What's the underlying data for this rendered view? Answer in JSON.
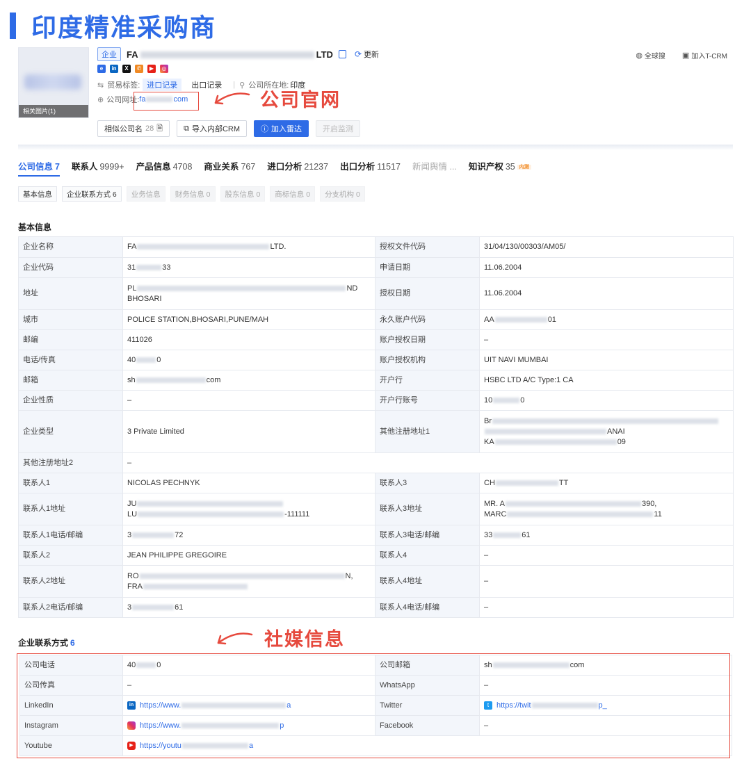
{
  "page_title": "印度精准采购商",
  "header": {
    "thumb_caption": "相关图片(1)",
    "tag": "企业",
    "company_name_start": "FA",
    "company_name_end": "LTD",
    "refresh_label": "更新",
    "trade_label": "贸易标签:",
    "trade_import": "进口记录",
    "trade_export": "出口记录",
    "location_label": "公司所在地:",
    "location_value": "印度",
    "website_label": "公司网址:",
    "website_start": "fa",
    "website_end": "com",
    "buttons": {
      "similar": "相似公司名",
      "similar_count": "28",
      "import_crm": "导入内部CRM",
      "add_radar": "加入雷达",
      "monitor": "开启监测"
    },
    "right": {
      "global_search": "全球搜",
      "add_crm": "加入T-CRM"
    }
  },
  "annotations": {
    "website": "公司官网",
    "social": "社媒信息"
  },
  "tabs": [
    {
      "label": "公司信息",
      "count": "7"
    },
    {
      "label": "联系人",
      "count": "9999+"
    },
    {
      "label": "产品信息",
      "count": "4708"
    },
    {
      "label": "商业关系",
      "count": "767"
    },
    {
      "label": "进口分析",
      "count": "21237"
    },
    {
      "label": "出口分析",
      "count": "11517"
    },
    {
      "label": "新闻舆情 ...",
      "count": ""
    },
    {
      "label": "知识产权",
      "count": "35",
      "badge": "内测"
    }
  ],
  "subtabs": [
    {
      "label": "基本信息"
    },
    {
      "label": "企业联系方式 6"
    },
    {
      "label": "业务信息"
    },
    {
      "label": "财务信息 0"
    },
    {
      "label": "股东信息 0"
    },
    {
      "label": "商标信息 0"
    },
    {
      "label": "分支机构 0"
    }
  ],
  "basic": {
    "title": "基本信息",
    "rows": [
      {
        "l1": "企业名称",
        "v1a": "FA",
        "v1b": "LTD.",
        "l2": "授权文件代码",
        "v2a": "31/04/130/00303/AM05/",
        "v2b": ""
      },
      {
        "l1": "企业代码",
        "v1a": "31",
        "v1b": "33",
        "l2": "申请日期",
        "v2a": "11.06.2004",
        "v2b": ""
      },
      {
        "l1": "地址",
        "v1a": "PL",
        "v1b": "ND",
        "v1c": "BHOSARI",
        "l2": "授权日期",
        "v2a": "11.06.2004",
        "v2b": ""
      },
      {
        "l1": "城市",
        "v1a": "POLICE STATION,BHOSARI,PUNE/MAH",
        "v1b": "",
        "l2": "永久账户代码",
        "v2a": "AA",
        "v2b": "01"
      },
      {
        "l1": "邮编",
        "v1a": "411026",
        "v1b": "",
        "l2": "账户授权日期",
        "v2a": "–",
        "v2b": ""
      },
      {
        "l1": "电话/传真",
        "v1a": "40",
        "v1b": "0",
        "l2": "账户授权机构",
        "v2a": "UIT NAVI MUMBAI",
        "v2b": ""
      },
      {
        "l1": "邮箱",
        "v1a": "sh",
        "v1b": "com",
        "l2": "开户行",
        "v2a": "HSBC LTD A/C Type:1 CA",
        "v2b": ""
      },
      {
        "l1": "企业性质",
        "v1a": "–",
        "v1b": "",
        "l2": "开户行账号",
        "v2a": "10",
        "v2b": "0"
      },
      {
        "l1": "企业类型",
        "v1a": "3 Private Limited",
        "v1b": "",
        "l2": "其他注册地址1",
        "v2a": "Br",
        "v2b": "ANAI",
        "v2c": "KA",
        "v2d": "09"
      },
      {
        "l1": "其他注册地址2",
        "v1a": "–"
      },
      {
        "l1": "联系人1",
        "v1a": "NICOLAS PECHNYK",
        "v1b": "",
        "l2": "联系人3",
        "v2a": "CH",
        "v2b": "TT"
      },
      {
        "l1": "联系人1地址",
        "v1a": "JU",
        "v1b": "",
        "v1c": "LU",
        "v1d": "-111111",
        "l2": "联系人3地址",
        "v2a": "MR. A",
        "v2b": "390,",
        "v2c": "MARC",
        "v2d": "11"
      },
      {
        "l1": "联系人1电话/邮编",
        "v1a": "3",
        "v1b": "72",
        "l2": "联系人3电话/邮编",
        "v2a": "33",
        "v2b": "61"
      },
      {
        "l1": "联系人2",
        "v1a": "JEAN PHILIPPE GREGOIRE",
        "v1b": "",
        "l2": "联系人4",
        "v2a": "–",
        "v2b": ""
      },
      {
        "l1": "联系人2地址",
        "v1a": "RO",
        "v1b": "N,",
        "v1c": "FRA",
        "v1d": "",
        "l2": "联系人4地址",
        "v2a": "–",
        "v2b": ""
      },
      {
        "l1": "联系人2电话/邮编",
        "v1a": "3",
        "v1b": "61",
        "l2": "联系人4电话/邮编",
        "v2a": "–",
        "v2b": ""
      }
    ]
  },
  "contact": {
    "title": "企业联系方式",
    "count": "6",
    "rows": [
      {
        "l1": "公司电话",
        "v1a": "40",
        "v1b": "0",
        "l2": "公司邮箱",
        "v2a": "sh",
        "v2b": "com"
      },
      {
        "l1": "公司传真",
        "v1a": "–",
        "v1b": "",
        "l2": "WhatsApp",
        "v2a": "–",
        "v2b": ""
      },
      {
        "l1": "LinkedIn",
        "v1a": "https://www.",
        "v1b": "a",
        "l2": "Twitter",
        "v2a": "https://twit",
        "v2b": "p_"
      },
      {
        "l1": "Instagram",
        "v1a": "https://www.",
        "v1b": "p",
        "l2": "Facebook",
        "v2a": "–",
        "v2b": ""
      },
      {
        "l1": "Youtube",
        "v1a": "https://youtu",
        "v1b": "a"
      }
    ]
  }
}
